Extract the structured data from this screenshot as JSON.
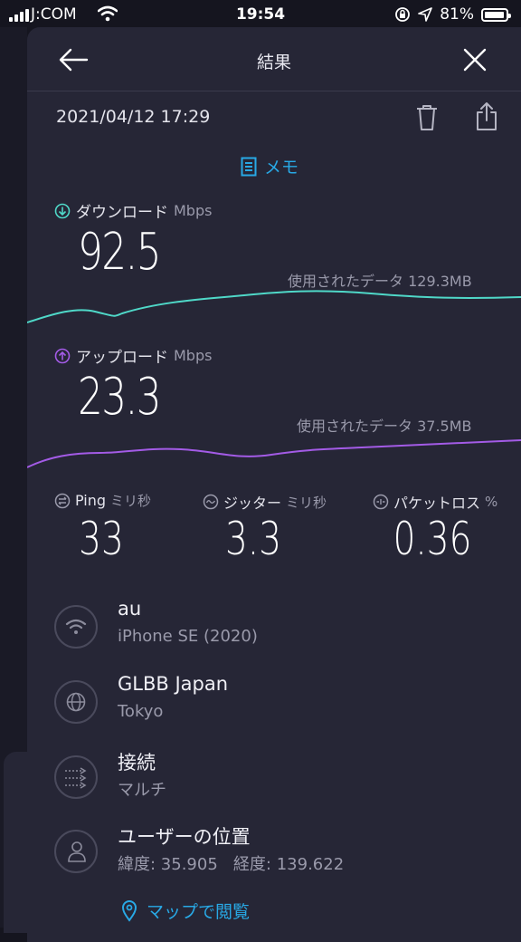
{
  "status_bar": {
    "carrier": "J:COM",
    "time": "19:54",
    "battery_text": "81%"
  },
  "nav": {
    "title": "結果"
  },
  "result": {
    "datetime": "2021/04/12 17:29",
    "memo_label": "メモ"
  },
  "download": {
    "label": "ダウンロード",
    "unit": "Mbps",
    "value": "92.5",
    "used_text": "使用されたデータ 129.3MB",
    "color": "#4fd8c8"
  },
  "upload": {
    "label": "アップロード",
    "unit": "Mbps",
    "value": "23.3",
    "used_text": "使用されたデータ 37.5MB",
    "color": "#a35be6"
  },
  "metrics": {
    "ping": {
      "label": "Ping",
      "unit": "ミリ秒",
      "value": "33"
    },
    "jitter": {
      "label": "ジッター",
      "unit": "ミリ秒",
      "value": "3.3"
    },
    "packet_loss": {
      "label": "パケットロス",
      "unit": "%",
      "value": "0.36"
    }
  },
  "details": [
    {
      "icon": "wifi-icon",
      "title": "au",
      "subtitle": "iPhone SE (2020)"
    },
    {
      "icon": "globe-icon",
      "title": "GLBB Japan",
      "subtitle": "Tokyo"
    },
    {
      "icon": "connections-icon",
      "title": "接続",
      "subtitle": "マルチ"
    },
    {
      "icon": "user-icon",
      "title": "ユーザーの位置",
      "subtitle": "緯度: 35.905   経度: 139.622"
    }
  ],
  "map_link": "マップで閲覧",
  "accent_color": "#28a9e6"
}
